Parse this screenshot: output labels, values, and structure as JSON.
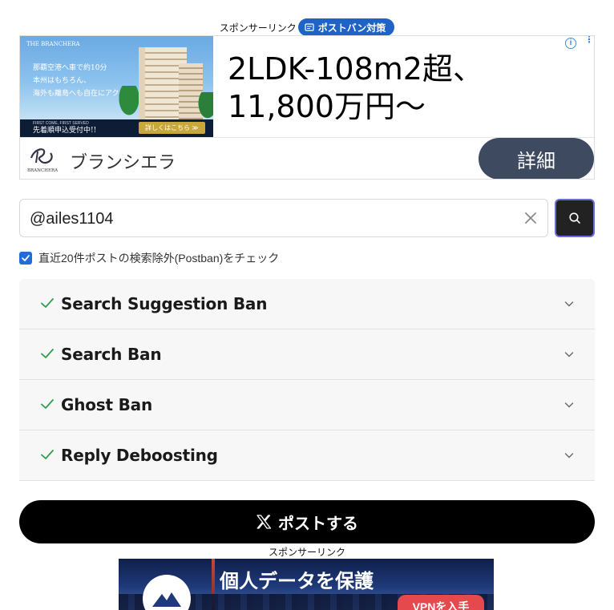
{
  "top_banner": {
    "sponsor_label": "スポンサーリンク",
    "badge_label": "ポストバン対策"
  },
  "ad_top": {
    "image_brand": "THE BRANCHERA",
    "image_line1": "那覇空港へ車で約10分",
    "image_line2": "本州はもちろん、",
    "image_line3": "海外も離島へも自在にアクセス",
    "image_first_come_en": "FIRST COME, FIRST SERVED",
    "image_first_come": "先着順申込受付中!!",
    "image_detail": "詳しくはこちら ≫",
    "headline": "2LDK-108m2超、11,800万円〜",
    "advertiser": "ブランシエラ",
    "logo_text": "BRANCHERA",
    "cta": "詳細"
  },
  "search": {
    "value": "@ailes1104",
    "placeholder": ""
  },
  "options": {
    "postban_label": "直近20件ポストの検索除外(Postban)をチェック",
    "postban_checked": true
  },
  "results": [
    {
      "label": "Search Suggestion Ban",
      "status": "ok"
    },
    {
      "label": "Search Ban",
      "status": "ok"
    },
    {
      "label": "Ghost Ban",
      "status": "ok"
    },
    {
      "label": "Reply Deboosting",
      "status": "ok"
    }
  ],
  "post_button": {
    "label": "ポストする"
  },
  "bottom_banner": {
    "sponsor_label": "スポンサーリンク"
  },
  "ad_bottom": {
    "headline": "個人データを保護",
    "cta": "VPNを入手"
  },
  "colors": {
    "badge": "#1f63c6",
    "check_green": "#2e9e4f",
    "cta_dark": "#3e4a60",
    "post_button": "#000000",
    "vpn_cta": "#e5484d"
  }
}
